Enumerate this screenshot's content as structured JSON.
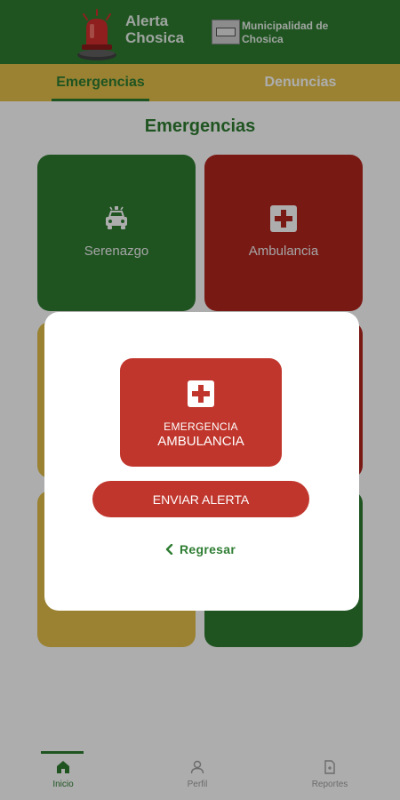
{
  "header": {
    "app_name_line1": "Alerta",
    "app_name_line2": "Chosica",
    "municipality_line1": "Municipalidad de",
    "municipality_line2": "Chosica"
  },
  "tabs": [
    {
      "label": "Emergencias",
      "active": true
    },
    {
      "label": "Denuncias",
      "active": false
    }
  ],
  "main": {
    "title": "Emergencias",
    "cards": [
      {
        "label": "Serenazgo",
        "icon": "police-car-icon",
        "color": "#2e7d32"
      },
      {
        "label": "Ambulancia",
        "icon": "medical-cross-icon",
        "color": "#b3261e"
      },
      {
        "label": "",
        "color": "#e3c04b"
      },
      {
        "label": "",
        "color": "#b3261e"
      },
      {
        "label": "",
        "color": "#e3c04b"
      },
      {
        "label": "",
        "color": "#2e7d32"
      }
    ]
  },
  "modal": {
    "card_line1": "EMERGENCIA",
    "card_line2": "AMBULANCIA",
    "card_icon": "medical-cross-icon",
    "send_button": "ENVIAR ALERTA",
    "back_link": "Regresar"
  },
  "bottom_nav": [
    {
      "label": "Inicio",
      "icon": "home-icon",
      "active": true
    },
    {
      "label": "Perfil",
      "icon": "user-icon",
      "active": false
    },
    {
      "label": "Reportes",
      "icon": "document-icon",
      "active": false
    }
  ],
  "colors": {
    "brand_green": "#2e7d32",
    "brand_yellow": "#e3c04b",
    "alert_red": "#c0362c"
  }
}
